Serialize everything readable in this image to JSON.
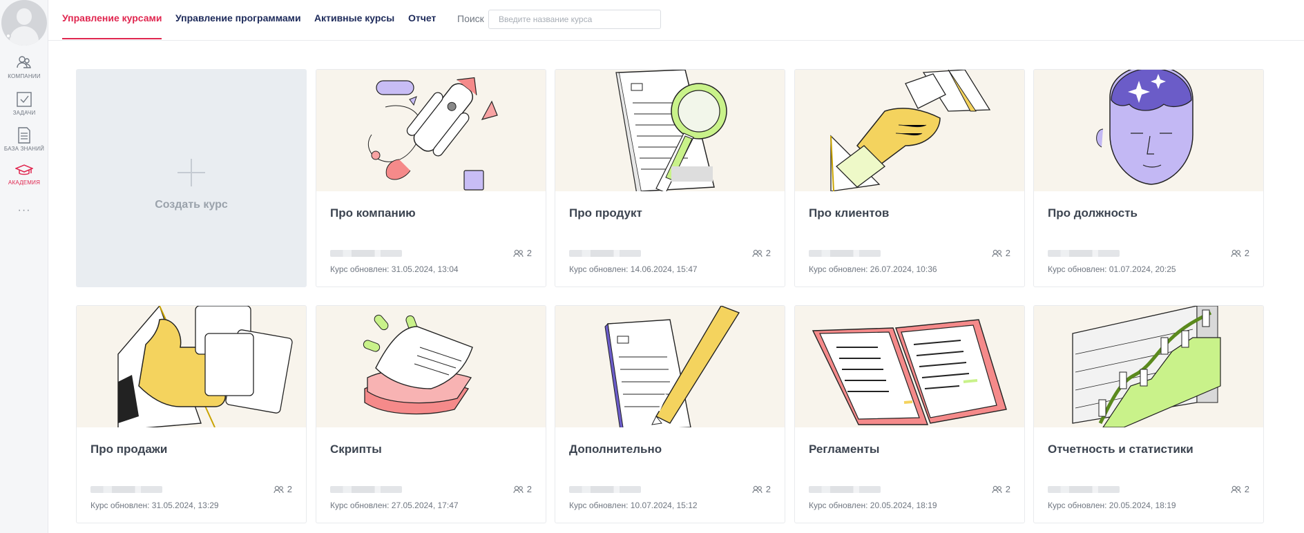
{
  "sidebar": {
    "items": [
      {
        "label": "Компании",
        "icon": "company-icon"
      },
      {
        "label": "Задачи",
        "icon": "tasks-icon"
      },
      {
        "label": "База знаний",
        "icon": "knowledge-base-icon"
      },
      {
        "label": "Академия",
        "icon": "academy-icon",
        "active": true
      }
    ],
    "more": "···"
  },
  "header": {
    "tabs": [
      {
        "label": "Управление курсами",
        "active": true
      },
      {
        "label": "Управление программами"
      },
      {
        "label": "Активные курсы"
      },
      {
        "label": "Отчет"
      }
    ],
    "search": {
      "label": "Поиск",
      "placeholder": "Введите название курса",
      "value": ""
    }
  },
  "create_course": {
    "label": "Создать курс",
    "icon": "plus-icon"
  },
  "courses": [
    {
      "title": "Про компанию",
      "members": "2",
      "updated": "Курс обновлен: 31.05.2024, 13:04",
      "illustration": "rocket"
    },
    {
      "title": "Про продукт",
      "members": "2",
      "updated": "Курс обновлен: 14.06.2024, 15:47",
      "illustration": "magnifier"
    },
    {
      "title": "Про клиентов",
      "members": "2",
      "updated": "Курс обновлен: 26.07.2024, 10:36",
      "illustration": "handshake"
    },
    {
      "title": "Про должность",
      "members": "2",
      "updated": "Курс обновлен: 01.07.2024, 20:25",
      "illustration": "head"
    },
    {
      "title": "Про продажи",
      "members": "2",
      "updated": "Курс обновлен: 31.05.2024, 13:29",
      "illustration": "thumbs-up"
    },
    {
      "title": "Скрипты",
      "members": "2",
      "updated": "Курс обновлен: 27.05.2024, 17:47",
      "illustration": "papers"
    },
    {
      "title": "Дополнительно",
      "members": "2",
      "updated": "Курс обновлен: 10.07.2024, 15:12",
      "illustration": "pen"
    },
    {
      "title": "Регламенты",
      "members": "2",
      "updated": "Курс обновлен: 20.05.2024, 18:19",
      "illustration": "book"
    },
    {
      "title": "Отчетность и статистики",
      "members": "2",
      "updated": "Курс обновлен: 20.05.2024, 18:19",
      "illustration": "chart"
    }
  ],
  "colors": {
    "accent": "#e0264f",
    "nav_text": "#1d2a5a",
    "card_bg": "#f8f4ec",
    "create_bg": "#e9edf1"
  }
}
